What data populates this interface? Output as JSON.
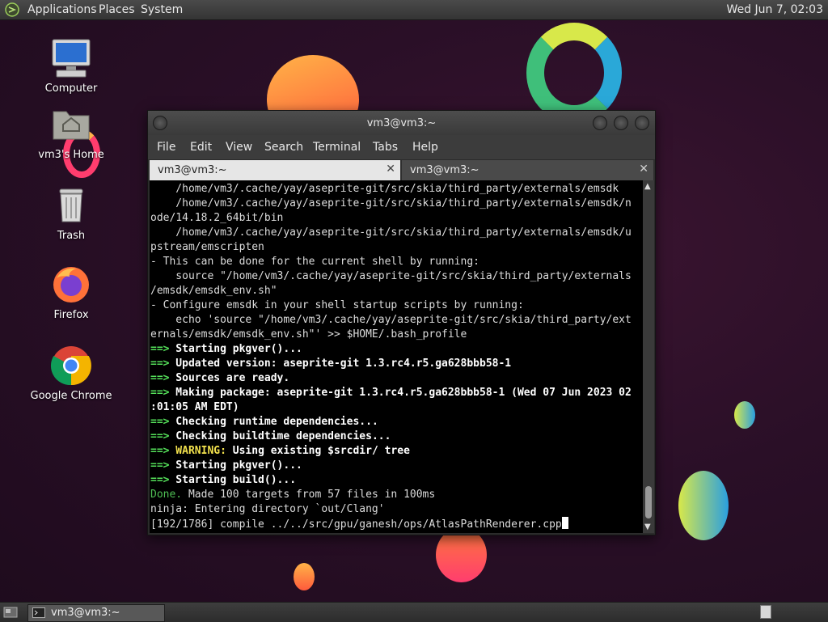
{
  "top_panel": {
    "menus": [
      "Applications",
      "Places",
      "System"
    ],
    "clock": "Wed Jun  7, 02:03"
  },
  "desktop": {
    "icons": [
      {
        "label": "Computer",
        "icon": "computer-icon"
      },
      {
        "label": "vm3's Home",
        "icon": "home-folder-icon"
      },
      {
        "label": "Trash",
        "icon": "trash-icon"
      },
      {
        "label": "Firefox",
        "icon": "firefox-icon"
      },
      {
        "label": "Google Chrome",
        "icon": "chrome-icon"
      }
    ]
  },
  "window": {
    "title": "vm3@vm3:~",
    "menu": [
      "File",
      "Edit",
      "View",
      "Search",
      "Terminal",
      "Tabs",
      "Help"
    ],
    "tabs": [
      {
        "label": "vm3@vm3:~",
        "active": true
      },
      {
        "label": "vm3@vm3:~",
        "active": false
      }
    ]
  },
  "terminal": {
    "lines": [
      {
        "text": "    /home/vm3/.cache/yay/aseprite-git/src/skia/third_party/externals/emsdk"
      },
      {
        "text": "    /home/vm3/.cache/yay/aseprite-git/src/skia/third_party/externals/emsdk/n"
      },
      {
        "text": "ode/14.18.2_64bit/bin"
      },
      {
        "text": "    /home/vm3/.cache/yay/aseprite-git/src/skia/third_party/externals/emsdk/u"
      },
      {
        "text": "pstream/emscripten"
      },
      {
        "text": "- This can be done for the current shell by running:"
      },
      {
        "text": "    source \"/home/vm3/.cache/yay/aseprite-git/src/skia/third_party/externals"
      },
      {
        "text": "/emsdk/emsdk_env.sh\""
      },
      {
        "text": "- Configure emsdk in your shell startup scripts by running:"
      },
      {
        "text": "    echo 'source \"/home/vm3/.cache/yay/aseprite-git/src/skia/third_party/ext"
      },
      {
        "text": "ernals/emsdk/emsdk_env.sh\"' >> $HOME/.bash_profile"
      },
      {
        "prefix": "==>",
        "text": " Starting pkgver()...",
        "style": "w"
      },
      {
        "prefix": "==>",
        "text": " Updated version: aseprite-git 1.3.rc4.r5.ga628bbb58-1",
        "style": "w"
      },
      {
        "prefix": "==>",
        "text": " Sources are ready.",
        "style": "w"
      },
      {
        "prefix": "==>",
        "text": " Making package: aseprite-git 1.3.rc4.r5.ga628bbb58-1 (Wed 07 Jun 2023 02",
        "style": "w"
      },
      {
        "text": ":01:05 AM EDT)",
        "style": "w"
      },
      {
        "prefix": "==>",
        "text": " Checking runtime dependencies...",
        "style": "w"
      },
      {
        "prefix": "==>",
        "text": " Checking buildtime dependencies...",
        "style": "w"
      },
      {
        "prefix": "==>",
        "warn": " WARNING:",
        "text": " Using existing $srcdir/ tree",
        "style": "w"
      },
      {
        "prefix": "==>",
        "text": " Starting pkgver()...",
        "style": "w"
      },
      {
        "prefix": "==>",
        "text": " Starting build()...",
        "style": "w"
      },
      {
        "done": "Done.",
        "text": " Made 100 targets from 57 files in 100ms"
      },
      {
        "text": "ninja: Entering directory `out/Clang'"
      },
      {
        "text": "[192/1786] compile ../../src/gpu/ganesh/ops/AtlasPathRenderer.cpp",
        "cursor": true
      }
    ]
  },
  "taskbar": {
    "task_label": "vm3@vm3:~"
  },
  "colors": {
    "prompt_green": "#55e15a",
    "warning_yellow": "#f3e24d",
    "terminal_bg": "#000000"
  }
}
